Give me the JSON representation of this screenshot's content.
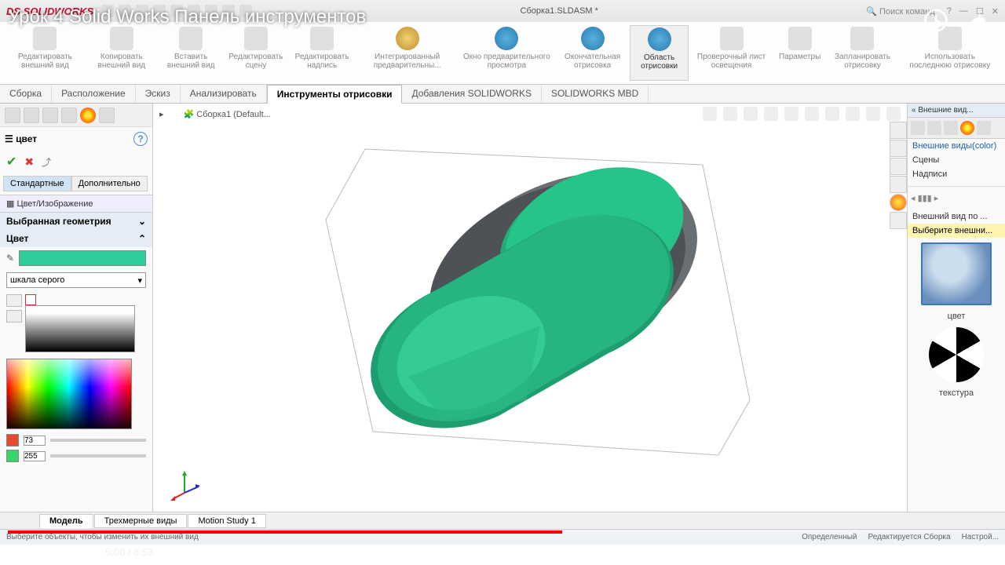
{
  "video": {
    "title": "Урок 4 Solid Works Панель инструментов",
    "current_time": "5:00",
    "total_time": "8:53"
  },
  "titlebar": {
    "logo": "SOLIDWORKS",
    "document": "Сборка1.SLDASM *",
    "search_placeholder": "Поиск команд"
  },
  "ribbon": {
    "items": [
      {
        "label": "Редактировать внешний вид"
      },
      {
        "label": "Копировать внешний вид"
      },
      {
        "label": "Вставить внешний вид"
      },
      {
        "label": "Редактировать сцену"
      },
      {
        "label": "Редактировать надпись"
      },
      {
        "label": "Интегрированный предварительны..."
      },
      {
        "label": "Окно предварительного просмотра"
      },
      {
        "label": "Окончательная отрисовка"
      },
      {
        "label": "Область отрисовки"
      },
      {
        "label": "Проверочный лист освещения"
      },
      {
        "label": "Параметры"
      },
      {
        "label": "Запланировать отрисовку"
      },
      {
        "label": "Использовать последнюю отрисовку"
      }
    ],
    "active_index": 8
  },
  "cmdtabs": {
    "items": [
      "Сборка",
      "Расположение",
      "Эскиз",
      "Анализировать",
      "Инструменты отрисовки",
      "Добавления SOLIDWORKS",
      "SOLIDWORKS MBD"
    ],
    "active": "Инструменты отрисовки"
  },
  "viewport": {
    "assembly_name": "Сборка1  (Default..."
  },
  "left_panel": {
    "title": "цвет",
    "tabs": {
      "standard": "Стандартные",
      "advanced": "Дополнительно"
    },
    "section_color_image": "Цвет/Изображение",
    "selected_geometry": "Выбранная геометрия",
    "color_header": "Цвет",
    "grayscale_label": "шкала серого",
    "slider1_value": "73",
    "slider2_value": "255",
    "color_swatch": "#2ecc9a",
    "slider1_color": "#e64a2e",
    "slider2_color": "#37d66a"
  },
  "right_panel": {
    "title": "Внешние вид...",
    "items": [
      "Внешние виды(color)",
      "Сцены",
      "Надписи"
    ],
    "default_appearance": "Внешний вид по ...",
    "select_hint": "Выберите внешни...",
    "thumb1_label": "цвет",
    "thumb2_label": "текстура"
  },
  "bottom_tabs": {
    "items": [
      "Модель",
      "Трехмерные виды",
      "Motion Study 1"
    ],
    "active": "Модель"
  },
  "statusbar": {
    "hint": "Выберите объекты, чтобы изменить их внешний вид",
    "status1": "Определенный",
    "status2": "Редактируется Сборка",
    "status3": "Настрой..."
  }
}
